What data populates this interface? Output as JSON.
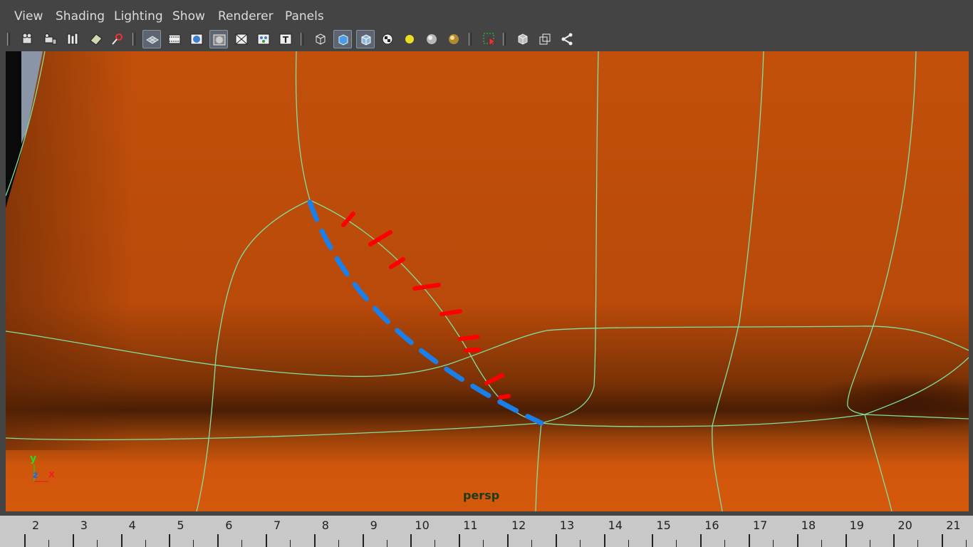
{
  "menu": {
    "items": [
      "View",
      "Shading",
      "Lighting",
      "Show",
      "Renderer",
      "Panels"
    ]
  },
  "toolbar": {
    "groups": [
      [
        "camera-select-icon",
        "camera-attributes-icon",
        "bookmarks-icon",
        "image-plane-icon",
        "two-d-pan-zoom-icon"
      ],
      [
        "grid-icon",
        "film-gate-icon",
        "resolution-gate-icon",
        "gate-mask-icon",
        "field-chart-icon",
        "safe-action-icon",
        "safe-title-icon"
      ],
      [
        "wireframe-icon",
        "smooth-shade-icon",
        "wireframe-on-shaded-icon",
        "textured-icon",
        "use-all-lights-icon",
        "shadows-icon",
        "screen-space-ao-icon"
      ],
      [
        "isolate-select-icon"
      ],
      [
        "xray-icon",
        "xray-joints-icon",
        "xray-components-icon"
      ]
    ]
  },
  "viewport": {
    "camera_label": "persp",
    "axis": {
      "y": "y",
      "z": "z",
      "x": "x"
    },
    "colors": {
      "surface": "#c4510c",
      "wireframe": "#7fe0a0",
      "annotation_blue": "#1a7fe8",
      "annotation_red": "#ff0000"
    }
  },
  "timeline": {
    "frames": [
      2,
      3,
      4,
      5,
      6,
      7,
      8,
      9,
      10,
      11,
      12,
      13,
      14,
      15,
      16,
      17,
      18,
      19,
      20,
      21
    ]
  }
}
